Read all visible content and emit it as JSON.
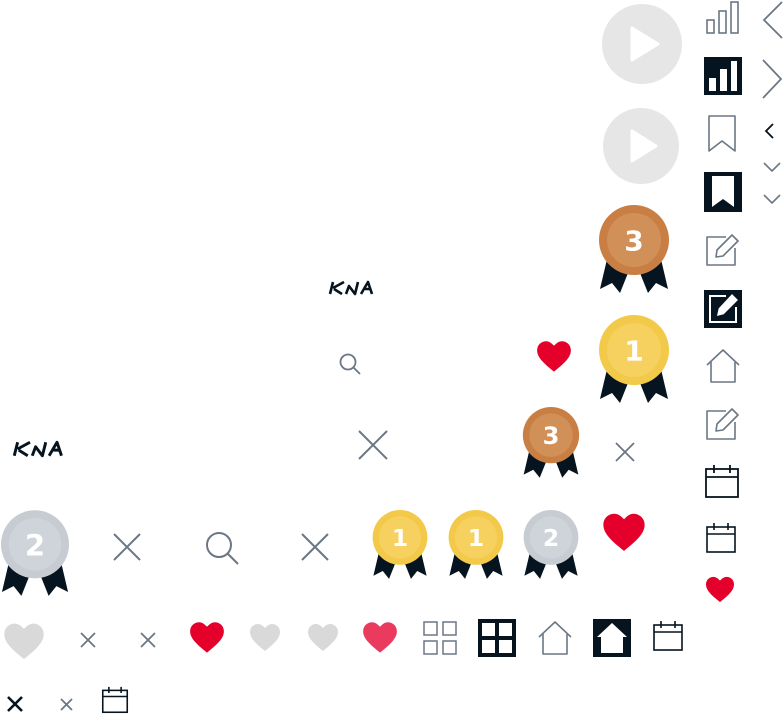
{
  "brand": {
    "logo_text": "KIA"
  },
  "colors": {
    "navy": "#05141f",
    "slate": "#6b7785",
    "light_gray": "#d9d9d9",
    "play_gray": "#e6e6e6",
    "heart_red": "#e4002b",
    "heart_pink": "#ea3a5e",
    "gold": "#f3c94a",
    "gold_inner": "#f6d15f",
    "silver": "#c7ccd3",
    "silver_inner": "#cfd4da",
    "bronze": "#c97f44",
    "bronze_inner": "#d29059"
  },
  "medals": [
    {
      "rank": "3",
      "tone": "bronze"
    },
    {
      "rank": "1",
      "tone": "gold"
    },
    {
      "rank": "3",
      "tone": "bronze"
    },
    {
      "rank": "2",
      "tone": "silver"
    },
    {
      "rank": "1",
      "tone": "gold"
    },
    {
      "rank": "1",
      "tone": "gold"
    },
    {
      "rank": "2",
      "tone": "silver"
    }
  ],
  "icons": [
    "play-icon",
    "chart-icon",
    "bookmark-icon",
    "edit-icon",
    "home-icon",
    "calendar-icon",
    "heart-icon",
    "close-icon",
    "search-icon",
    "grid-icon",
    "chevron-left-icon",
    "chevron-right-icon",
    "chevron-down-icon",
    "kia-logo",
    "medal-icon"
  ]
}
